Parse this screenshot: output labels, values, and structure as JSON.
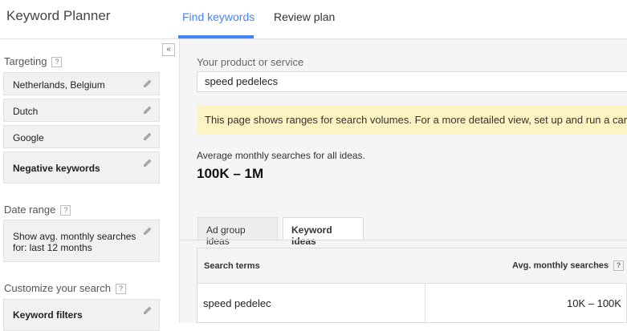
{
  "header": {
    "app_title": "Keyword Planner",
    "tabs": [
      {
        "label": "Find keywords",
        "active": true
      },
      {
        "label": "Review plan",
        "active": false
      }
    ],
    "accent_color": "#4285f4"
  },
  "sidebar": {
    "collapse_icon": "double-chevron-left-icon",
    "targeting": {
      "title": "Targeting",
      "help": "?",
      "items": [
        {
          "label": "Netherlands, Belgium"
        },
        {
          "label": "Dutch"
        },
        {
          "label": "Google"
        },
        {
          "label": "Negative keywords"
        }
      ]
    },
    "date_range": {
      "title": "Date range",
      "help": "?",
      "value_line1": "Show avg. monthly searches",
      "value_line2": "for: last 12 months"
    },
    "customize": {
      "title": "Customize your search",
      "help": "?",
      "items": [
        {
          "label": "Keyword filters"
        }
      ]
    }
  },
  "main": {
    "product_label": "Your product or service",
    "product_value": "speed pedelecs",
    "notice": "This page shows ranges for search volumes. For a more detailed view, set up and run a car",
    "notice_bg": "#fdf4c4",
    "avg_label": "Average monthly searches for all ideas.",
    "avg_value": "100K – 1M",
    "idea_tabs": [
      {
        "label": "Ad group ideas",
        "active": false
      },
      {
        "label": "Keyword ideas",
        "active": true
      }
    ],
    "table": {
      "headers": [
        "Search terms",
        "Avg. monthly searches"
      ],
      "header_help": "?",
      "rows": [
        {
          "term": "speed pedelec",
          "avg": "10K – 100K"
        }
      ]
    }
  }
}
